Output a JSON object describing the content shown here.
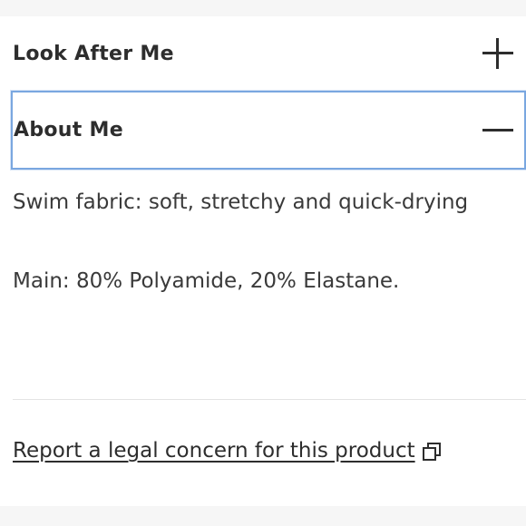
{
  "accordion": {
    "look_after": {
      "title": "Look After Me",
      "icon": "plus-icon",
      "expanded": false
    },
    "about": {
      "title": "About Me",
      "icon": "minus-icon",
      "expanded": true,
      "focus_color": "#7aa7e0",
      "content": {
        "line1": "Swim fabric: soft, stretchy and quick-drying",
        "line2": "Main: 80% Polyamide, 20% Elastane."
      }
    }
  },
  "legal": {
    "link_text": "Report a legal concern for this product",
    "icon": "external-link-icon"
  }
}
